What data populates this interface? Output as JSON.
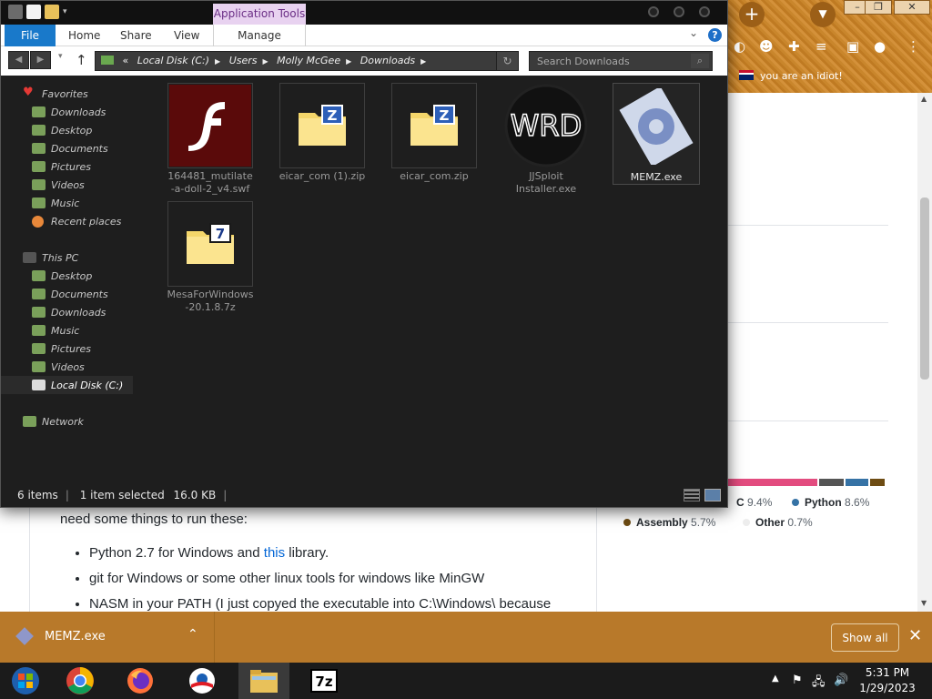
{
  "explorer": {
    "context_tab": "Application Tools",
    "ribbon_tabs": [
      "File",
      "Home",
      "Share",
      "View",
      "Manage"
    ],
    "breadcrumb": [
      "Local Disk (C:)",
      "Users",
      "Molly McGee",
      "Downloads"
    ],
    "search_placeholder": "Search Downloads",
    "nav": {
      "favorites": "Favorites",
      "favorites_items": [
        "Downloads",
        "Desktop",
        "Documents",
        "Pictures",
        "Videos",
        "Music",
        "Recent places"
      ],
      "this_pc": "This PC",
      "pc_items": [
        "Desktop",
        "Documents",
        "Downloads",
        "Music",
        "Pictures",
        "Videos",
        "Local Disk (C:)"
      ],
      "network": "Network"
    },
    "files": [
      {
        "name": "164481_mutilate-a-doll-2_v4.swf",
        "kind": "swf"
      },
      {
        "name": "eicar_com (1).zip",
        "kind": "zip"
      },
      {
        "name": "eicar_com.zip",
        "kind": "zip"
      },
      {
        "name": "JJSploit Installer.exe",
        "kind": "wrd"
      },
      {
        "name": "MEMZ.exe",
        "kind": "memz",
        "selected": true
      },
      {
        "name": "MesaForWindows-20.1.8.7z",
        "kind": "7z"
      }
    ],
    "status": {
      "count": "6 items",
      "selected": "1 item selected",
      "size": "16.0 KB"
    }
  },
  "browser": {
    "bookmark": "you are an idiot!",
    "content": {
      "intro": "need some things to run these:",
      "list": [
        {
          "pre": "Python 2.7 for Windows and ",
          "link": "this",
          "post": " library."
        },
        {
          "pre": "git for Windows or some other linux tools for windows like MinGW",
          "link": "",
          "post": ""
        },
        {
          "pre": "NASM in your PATH (I just copyed the executable into C:\\Windows\\ because",
          "link": "",
          "post": ""
        }
      ]
    },
    "languages": [
      {
        "name": "C",
        "pct": "9.4%",
        "color": "#555555"
      },
      {
        "name": "Python",
        "pct": "8.6%",
        "color": "#3572A5"
      },
      {
        "name": "Assembly",
        "pct": "5.7%",
        "color": "#6E4C13"
      },
      {
        "name": "Other",
        "pct": "0.7%",
        "color": "#ededed"
      }
    ]
  },
  "download_bar": {
    "file": "MEMZ.exe",
    "show_all": "Show all"
  },
  "taskbar": {
    "time": "5:31 PM",
    "date": "1/29/2023"
  }
}
